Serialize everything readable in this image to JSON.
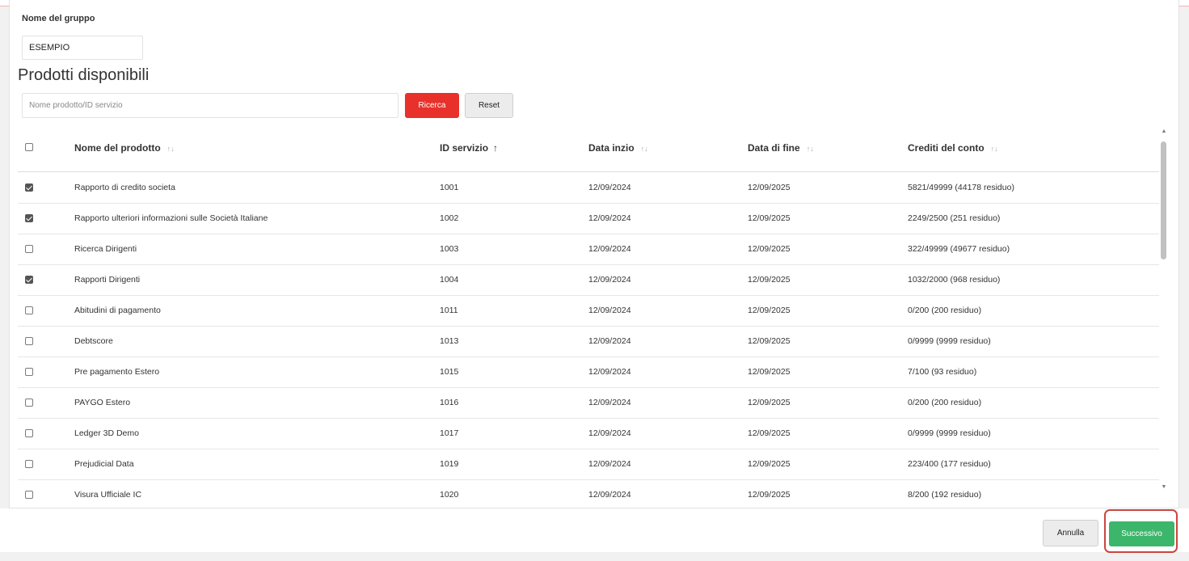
{
  "colors": {
    "accent_red": "#e8312a",
    "primary_green": "#3cb66a",
    "highlight": "#c9463f"
  },
  "group": {
    "label": "Nome del gruppo",
    "value": "ESEMPIO"
  },
  "section_title": "Prodotti disponibili",
  "search": {
    "placeholder": "Nome prodotto/ID servizio",
    "value": "",
    "search_label": "Ricerca",
    "reset_label": "Reset"
  },
  "table": {
    "headers": {
      "select_all": false,
      "product_name": "Nome del prodotto",
      "service_id": "ID servizio",
      "start_date": "Data inzio",
      "end_date": "Data di fine",
      "credits": "Crediti del conto"
    },
    "sort": {
      "column": "service_id",
      "direction": "ascending"
    },
    "rows": [
      {
        "checked": true,
        "name": "Rapporto di credito societa",
        "id": "1001",
        "start": "12/09/2024",
        "end": "12/09/2025",
        "credits": "5821/49999 (44178 residuo)"
      },
      {
        "checked": true,
        "name": "Rapporto ulteriori informazioni sulle Società Italiane",
        "id": "1002",
        "start": "12/09/2024",
        "end": "12/09/2025",
        "credits": "2249/2500 (251 residuo)"
      },
      {
        "checked": false,
        "name": "Ricerca Dirigenti",
        "id": "1003",
        "start": "12/09/2024",
        "end": "12/09/2025",
        "credits": "322/49999 (49677 residuo)"
      },
      {
        "checked": true,
        "name": "Rapporti Dirigenti",
        "id": "1004",
        "start": "12/09/2024",
        "end": "12/09/2025",
        "credits": "1032/2000 (968 residuo)"
      },
      {
        "checked": false,
        "name": "Abitudini di pagamento",
        "id": "1011",
        "start": "12/09/2024",
        "end": "12/09/2025",
        "credits": "0/200 (200 residuo)"
      },
      {
        "checked": false,
        "name": "Debtscore",
        "id": "1013",
        "start": "12/09/2024",
        "end": "12/09/2025",
        "credits": "0/9999 (9999 residuo)"
      },
      {
        "checked": false,
        "name": "Pre pagamento Estero",
        "id": "1015",
        "start": "12/09/2024",
        "end": "12/09/2025",
        "credits": "7/100 (93 residuo)"
      },
      {
        "checked": false,
        "name": "PAYGO Estero",
        "id": "1016",
        "start": "12/09/2024",
        "end": "12/09/2025",
        "credits": "0/200 (200 residuo)"
      },
      {
        "checked": false,
        "name": "Ledger 3D Demo",
        "id": "1017",
        "start": "12/09/2024",
        "end": "12/09/2025",
        "credits": "0/9999 (9999 residuo)"
      },
      {
        "checked": false,
        "name": "Prejudicial Data",
        "id": "1019",
        "start": "12/09/2024",
        "end": "12/09/2025",
        "credits": "223/400 (177 residuo)"
      },
      {
        "checked": false,
        "name": "Visura Ufficiale IC",
        "id": "1020",
        "start": "12/09/2024",
        "end": "12/09/2025",
        "credits": "8/200 (192 residuo)"
      }
    ]
  },
  "footer": {
    "cancel_label": "Annulla",
    "next_label": "Successivo"
  }
}
